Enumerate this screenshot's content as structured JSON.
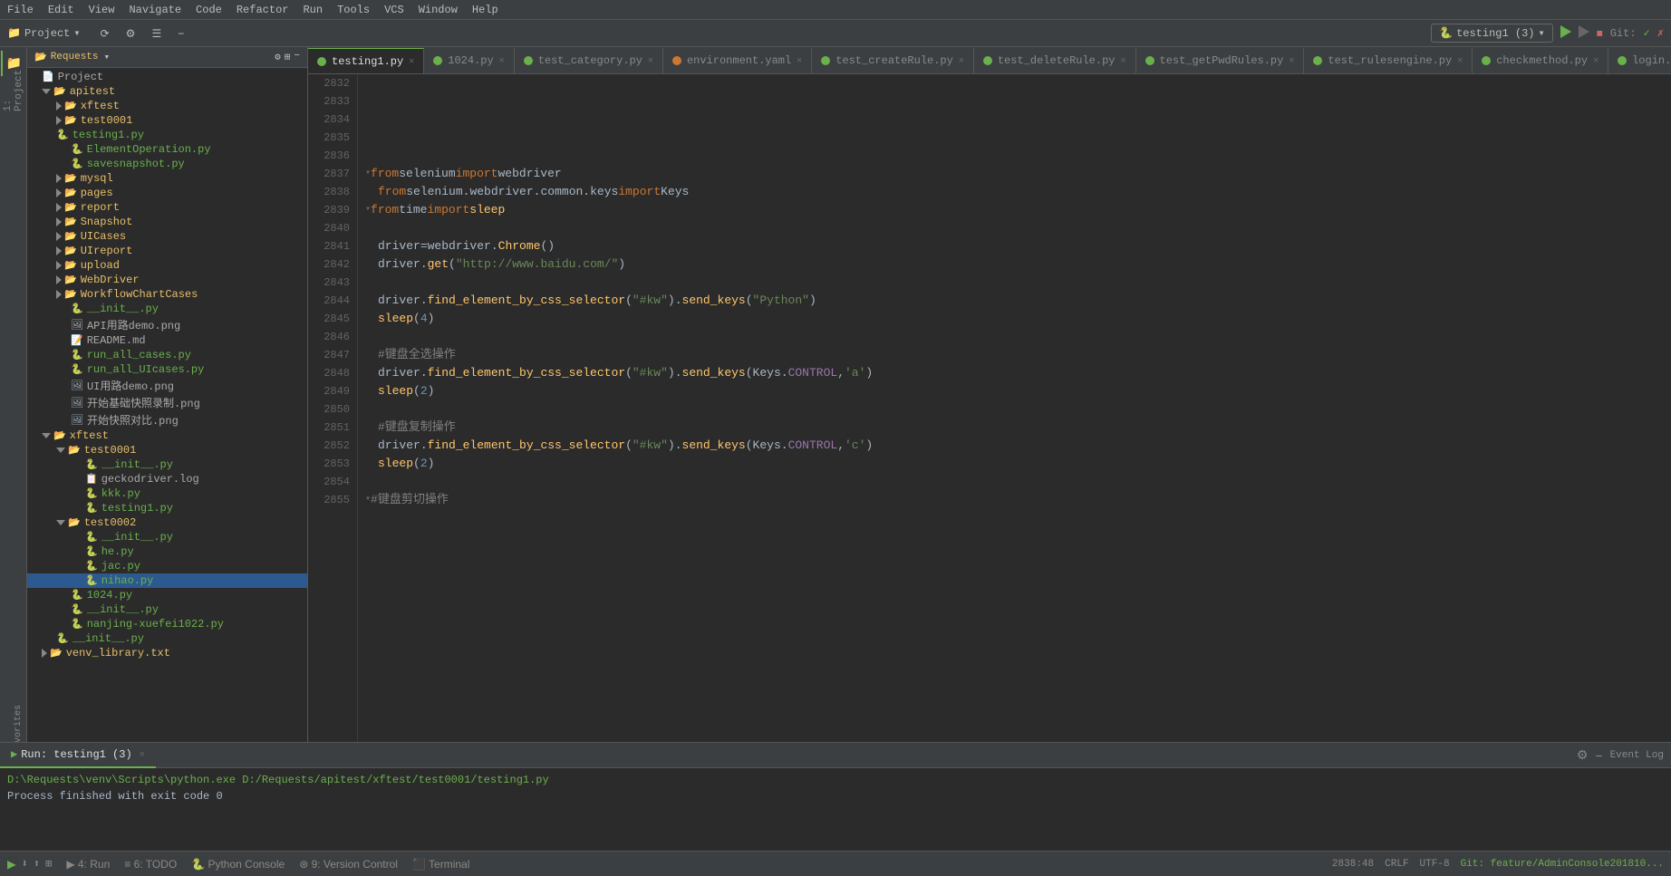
{
  "menubar": {
    "items": [
      "File",
      "Edit",
      "View",
      "Navigate",
      "Code",
      "Refactor",
      "Run",
      "Tools",
      "VCS",
      "Window",
      "Help"
    ]
  },
  "toolbar": {
    "project_label": "Project",
    "run_config": "testing1 (3)",
    "git_label": "Git:",
    "icons": [
      "sync",
      "settings",
      "layout",
      "close"
    ]
  },
  "tabs": [
    {
      "label": "testing1.py",
      "type": "py",
      "active": true
    },
    {
      "label": "1024.py",
      "type": "py",
      "active": false
    },
    {
      "label": "test_category.py",
      "type": "py",
      "active": false
    },
    {
      "label": "environment.yaml",
      "type": "yaml",
      "active": false
    },
    {
      "label": "test_createRule.py",
      "type": "py",
      "active": false
    },
    {
      "label": "test_deleteRule.py",
      "type": "py",
      "active": false
    },
    {
      "label": "test_getPwdRules.py",
      "type": "py",
      "active": false
    },
    {
      "label": "test_rulesengine.py",
      "type": "py",
      "active": false
    },
    {
      "label": "checkmethod.py",
      "type": "py",
      "active": false
    },
    {
      "label": "login.py",
      "type": "py",
      "active": false
    }
  ],
  "project_tree": {
    "root": "Requests",
    "items": [
      {
        "indent": 0,
        "type": "project",
        "label": "Project",
        "open": true
      },
      {
        "indent": 1,
        "type": "folder",
        "label": "apitest",
        "open": true
      },
      {
        "indent": 2,
        "type": "folder",
        "label": "xftest",
        "open": false
      },
      {
        "indent": 2,
        "type": "folder",
        "label": "test0001",
        "open": false
      },
      {
        "indent": 1,
        "type": "file",
        "label": "testing1.py",
        "ext": "py"
      },
      {
        "indent": 2,
        "type": "file",
        "label": "ElementOperation.py",
        "ext": "py"
      },
      {
        "indent": 2,
        "type": "file",
        "label": "savesnapshot.py",
        "ext": "py"
      },
      {
        "indent": 2,
        "type": "folder",
        "label": "mysql",
        "open": false
      },
      {
        "indent": 2,
        "type": "folder",
        "label": "pages",
        "open": false
      },
      {
        "indent": 2,
        "type": "folder",
        "label": "report",
        "open": false
      },
      {
        "indent": 2,
        "type": "folder",
        "label": "Snapshot",
        "open": false
      },
      {
        "indent": 2,
        "type": "folder",
        "label": "UICases",
        "open": false
      },
      {
        "indent": 2,
        "type": "folder",
        "label": "UIreport",
        "open": false
      },
      {
        "indent": 2,
        "type": "folder",
        "label": "upload",
        "open": false
      },
      {
        "indent": 2,
        "type": "folder",
        "label": "WebDriver",
        "open": false
      },
      {
        "indent": 2,
        "type": "folder",
        "label": "WorkflowChartCases",
        "open": false
      },
      {
        "indent": 2,
        "type": "file",
        "label": "__init__.py",
        "ext": "py"
      },
      {
        "indent": 2,
        "type": "file",
        "label": "API用路demo.png",
        "ext": "png"
      },
      {
        "indent": 2,
        "type": "file",
        "label": "README.md",
        "ext": "txt"
      },
      {
        "indent": 2,
        "type": "file",
        "label": "run_all_cases.py",
        "ext": "py"
      },
      {
        "indent": 2,
        "type": "file",
        "label": "run_all_UIcases.py",
        "ext": "py"
      },
      {
        "indent": 2,
        "type": "file",
        "label": "UI用路demo.png",
        "ext": "png"
      },
      {
        "indent": 2,
        "type": "file",
        "label": "开始基础快照录制.png",
        "ext": "png"
      },
      {
        "indent": 2,
        "type": "file",
        "label": "开始快照对比.png",
        "ext": "png"
      },
      {
        "indent": 1,
        "type": "folder",
        "label": "xftest",
        "open": true
      },
      {
        "indent": 2,
        "type": "folder",
        "label": "test0001",
        "open": true
      },
      {
        "indent": 3,
        "type": "file",
        "label": "__init__.py",
        "ext": "py"
      },
      {
        "indent": 3,
        "type": "file",
        "label": "geckodriver.log",
        "ext": "log"
      },
      {
        "indent": 3,
        "type": "file",
        "label": "kkk.py",
        "ext": "py"
      },
      {
        "indent": 3,
        "type": "file",
        "label": "testing1.py",
        "ext": "py"
      },
      {
        "indent": 2,
        "type": "folder",
        "label": "test0002",
        "open": true
      },
      {
        "indent": 3,
        "type": "file",
        "label": "__init__.py",
        "ext": "py"
      },
      {
        "indent": 3,
        "type": "file",
        "label": "he.py",
        "ext": "py"
      },
      {
        "indent": 3,
        "type": "file",
        "label": "jac.py",
        "ext": "py"
      },
      {
        "indent": 3,
        "type": "file",
        "label": "nihao.py",
        "ext": "py",
        "selected": true
      },
      {
        "indent": 2,
        "type": "file",
        "label": "1024.py",
        "ext": "py"
      },
      {
        "indent": 2,
        "type": "file",
        "label": "__init__.py",
        "ext": "py"
      },
      {
        "indent": 2,
        "type": "file",
        "label": "nanjing-xuefei1022.py",
        "ext": "py"
      },
      {
        "indent": 1,
        "type": "file",
        "label": "__init__.py",
        "ext": "py"
      },
      {
        "indent": 1,
        "type": "folder",
        "label": "venv_library.txt",
        "open": false
      }
    ]
  },
  "line_numbers": [
    2832,
    2833,
    2834,
    2835,
    2836,
    2837,
    2838,
    2839,
    2840,
    2841,
    2842,
    2843,
    2844,
    2845,
    2846,
    2847,
    2848,
    2849,
    2850,
    2851,
    2852,
    2853,
    2854,
    2855
  ],
  "code_lines": [
    {
      "num": 2832,
      "content": "",
      "fold": false
    },
    {
      "num": 2833,
      "content": "",
      "fold": false
    },
    {
      "num": 2834,
      "content": "",
      "fold": false
    },
    {
      "num": 2835,
      "content": "",
      "fold": false
    },
    {
      "num": 2836,
      "content": "",
      "fold": false
    },
    {
      "num": 2837,
      "content": "from selenium import webdriver",
      "fold": true
    },
    {
      "num": 2838,
      "content": "from selenium.webdriver.common.keys import Keys",
      "fold": false
    },
    {
      "num": 2839,
      "content": "from time import sleep",
      "fold": true
    },
    {
      "num": 2840,
      "content": "",
      "fold": false
    },
    {
      "num": 2841,
      "content": "driver=webdriver.Chrome()",
      "fold": false
    },
    {
      "num": 2842,
      "content": "driver.get(\"http://www.baidu.com/\")",
      "fold": false
    },
    {
      "num": 2843,
      "content": "",
      "fold": false
    },
    {
      "num": 2844,
      "content": "driver.find_element_by_css_selector(\"#kw\").send_keys(\"Python\")",
      "fold": false
    },
    {
      "num": 2845,
      "content": "sleep(4)",
      "fold": false
    },
    {
      "num": 2846,
      "content": "",
      "fold": false
    },
    {
      "num": 2847,
      "content": "#键盘全选操作",
      "fold": false
    },
    {
      "num": 2848,
      "content": "driver.find_element_by_css_selector(\"#kw\").send_keys(Keys.CONTROL,'a')",
      "fold": false
    },
    {
      "num": 2849,
      "content": "sleep(2)",
      "fold": false
    },
    {
      "num": 2850,
      "content": "",
      "fold": false
    },
    {
      "num": 2851,
      "content": "#键盘复制操作",
      "fold": false
    },
    {
      "num": 2852,
      "content": "driver.find_element_by_css_selector(\"#kw\").send_keys(Keys.CONTROL,'c')",
      "fold": false
    },
    {
      "num": 2853,
      "content": "sleep(2)",
      "fold": false
    },
    {
      "num": 2854,
      "content": "",
      "fold": false
    },
    {
      "num": 2855,
      "content": "#键盘剪切操作",
      "fold": true
    }
  ],
  "bottom_panel": {
    "tabs": [
      {
        "label": "Run: testing1 (3)",
        "active": true,
        "closable": true
      }
    ],
    "output": [
      "D:\\Requests\\venv\\Scripts\\python.exe D:/Requests/apitest/xftest/test0001/testing1.py",
      "",
      "Process finished with exit code 0"
    ]
  },
  "status_bar": {
    "line_col": "2838:48",
    "crlf": "CRLF",
    "encoding": "UTF-8",
    "branch": "Git: feature/AdminConsole201810..."
  },
  "action_bar": {
    "run_label": "▶",
    "stop_label": "⏹",
    "tabs": [
      "▶ 4: Run",
      "≡ 6: TODO",
      "🐍 Python Console",
      "9: Version Control",
      "⬛ Terminal"
    ]
  }
}
